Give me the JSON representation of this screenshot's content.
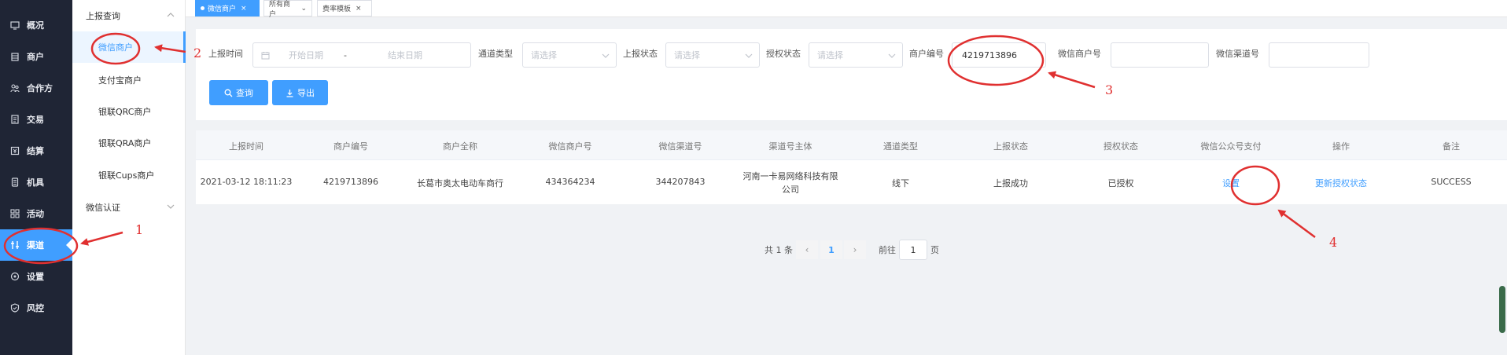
{
  "nav": {
    "items": [
      {
        "label": "概况",
        "icon": "monitor-icon"
      },
      {
        "label": "商户",
        "icon": "store-icon"
      },
      {
        "label": "合作方",
        "icon": "partner-icon"
      },
      {
        "label": "交易",
        "icon": "document-icon"
      },
      {
        "label": "结算",
        "icon": "settlement-icon"
      },
      {
        "label": "机具",
        "icon": "device-icon"
      },
      {
        "label": "活动",
        "icon": "grid-icon"
      },
      {
        "label": "渠道",
        "icon": "channel-icon"
      },
      {
        "label": "设置",
        "icon": "gear-icon"
      },
      {
        "label": "风控",
        "icon": "shield-icon"
      }
    ],
    "active_index": 7
  },
  "submenu": {
    "group1": "上报查询",
    "items": [
      "微信商户",
      "支付宝商户",
      "银联QRC商户",
      "银联QRA商户",
      "银联Cups商户"
    ],
    "active_index": 0,
    "group2": "微信认证"
  },
  "tags": [
    {
      "label": "微信商户",
      "close": "×"
    },
    {
      "label": "所有商户",
      "close": "⌄"
    },
    {
      "label": "费率模板",
      "close": "×"
    }
  ],
  "filters": {
    "report_time_label": "上报时间",
    "start_placeholder": "开始日期",
    "range_sep": "-",
    "end_placeholder": "结束日期",
    "channel_type_label": "通道类型",
    "channel_type_placeholder": "请选择",
    "report_status_label": "上报状态",
    "report_status_placeholder": "请选择",
    "auth_status_label": "授权状态",
    "auth_status_placeholder": "请选择",
    "merchant_no_label": "商户编号",
    "merchant_no_value": "4219713896",
    "wx_merchant_label": "微信商户号",
    "wx_merchant_value": "",
    "wx_channel_label": "微信渠道号",
    "wx_channel_value": "",
    "search_button": "查询",
    "export_button": "导出"
  },
  "table": {
    "headers": [
      "上报时间",
      "商户编号",
      "商户全称",
      "微信商户号",
      "微信渠道号",
      "渠道号主体",
      "通道类型",
      "上报状态",
      "授权状态",
      "微信公众号支付",
      "操作",
      "备注"
    ],
    "rows": [
      {
        "report_time": "2021-03-12 18:11:23",
        "merchant_no": "4219713896",
        "merchant_name": "长葛市奥太电动车商行",
        "wx_merchant_no": "434364234",
        "wx_channel_no": "344207843",
        "channel_subject_line1": "河南一卡易网络科技有限",
        "channel_subject_line2": "公司",
        "channel_type": "线下",
        "report_status": "上报成功",
        "auth_status": "已授权",
        "wx_pay_action": "设置",
        "operation": "更新授权状态",
        "remark": "SUCCESS"
      }
    ]
  },
  "pagination": {
    "total": "共 1 条",
    "prev": "‹",
    "current": "1",
    "next": "›",
    "goto_label": "前往",
    "goto_value": "1",
    "page_unit": "页"
  },
  "annotations": [
    "1",
    "2",
    "3",
    "4"
  ],
  "colors": {
    "accent": "#409eff",
    "nav_bg": "#1f2535",
    "annotation": "#e03030"
  }
}
